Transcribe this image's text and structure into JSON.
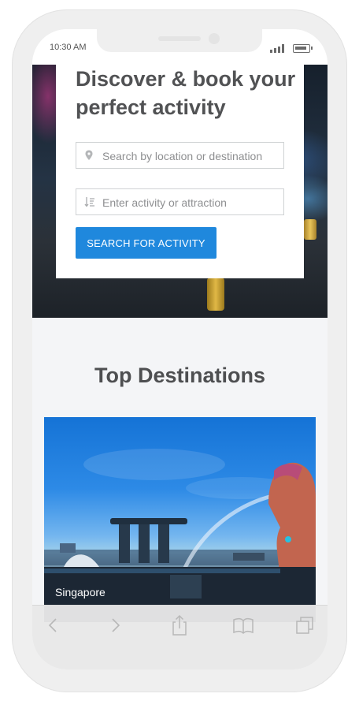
{
  "status_bar": {
    "time": "10:30 AM"
  },
  "hero": {
    "title": "Discover & book your perfect activity",
    "location_field": {
      "placeholder": "Search by location or destination",
      "icon": "map-pin-icon"
    },
    "activity_field": {
      "placeholder": "Enter activity or attraction",
      "icon": "sort-list-icon"
    },
    "search_button": "SEARCH FOR ACTIVITY"
  },
  "destinations": {
    "title": "Top Destinations",
    "items": [
      {
        "label": "Singapore"
      }
    ]
  },
  "toolbar": {
    "icons": [
      "back-icon",
      "forward-icon",
      "share-icon",
      "bookmarks-icon",
      "tabs-icon"
    ]
  },
  "colors": {
    "accent": "#1f88dd",
    "heading": "#515254",
    "section_bg": "#f4f5f7"
  }
}
